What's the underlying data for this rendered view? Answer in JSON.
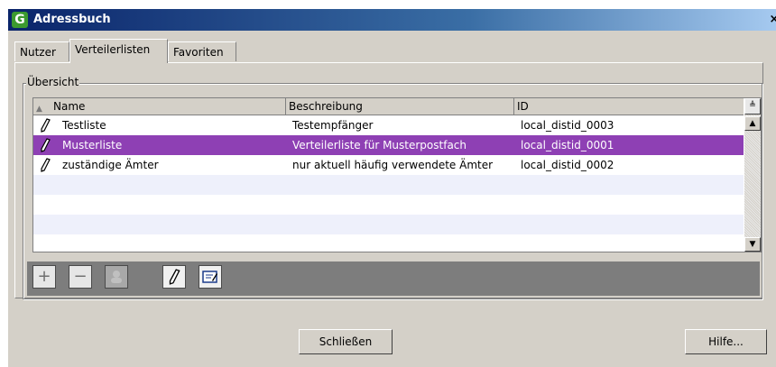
{
  "window": {
    "title": "Adressbuch",
    "app_icon_letter": "G",
    "close_glyph": "×"
  },
  "tabs": [
    {
      "label": "Nutzer"
    },
    {
      "label": "Verteilerlisten"
    },
    {
      "label": "Favoriten"
    }
  ],
  "overview": {
    "label": "Übersicht",
    "columns": [
      "Name",
      "Beschreibung",
      "ID"
    ],
    "rows": [
      {
        "name": "Testliste",
        "description": "Testempfänger",
        "id": "local_distid_0003"
      },
      {
        "name": "Musterliste",
        "description": "Verteilerliste für Musterpostfach",
        "id": "local_distid_0001"
      },
      {
        "name": "zuständige Ämter",
        "description": "nur aktuell häufig verwendete Ämter",
        "id": "local_distid_0002"
      }
    ],
    "selected_row": "Musterliste"
  },
  "toolbar": {
    "add": "+",
    "remove": "−"
  },
  "buttons": {
    "close": "Schließen",
    "help": "Hilfe..."
  },
  "colors": {
    "selection": "#8e40b4",
    "stripe": "#eef0fb"
  }
}
